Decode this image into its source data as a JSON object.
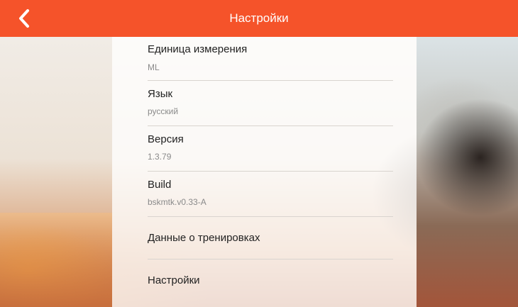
{
  "header": {
    "title": "Настройки",
    "back_icon": "chevron-left-icon",
    "background_color": "#f5532a"
  },
  "settings": {
    "items": [
      {
        "label": "Единица измерения",
        "value": "ML"
      },
      {
        "label": "Язык",
        "value": "русский"
      },
      {
        "label": "Версия",
        "value": "1.3.79"
      },
      {
        "label": "Build",
        "value": "bskmtk.v0.33-A"
      },
      {
        "label": "Данные о тренировках"
      },
      {
        "label": "Настройки"
      }
    ]
  }
}
